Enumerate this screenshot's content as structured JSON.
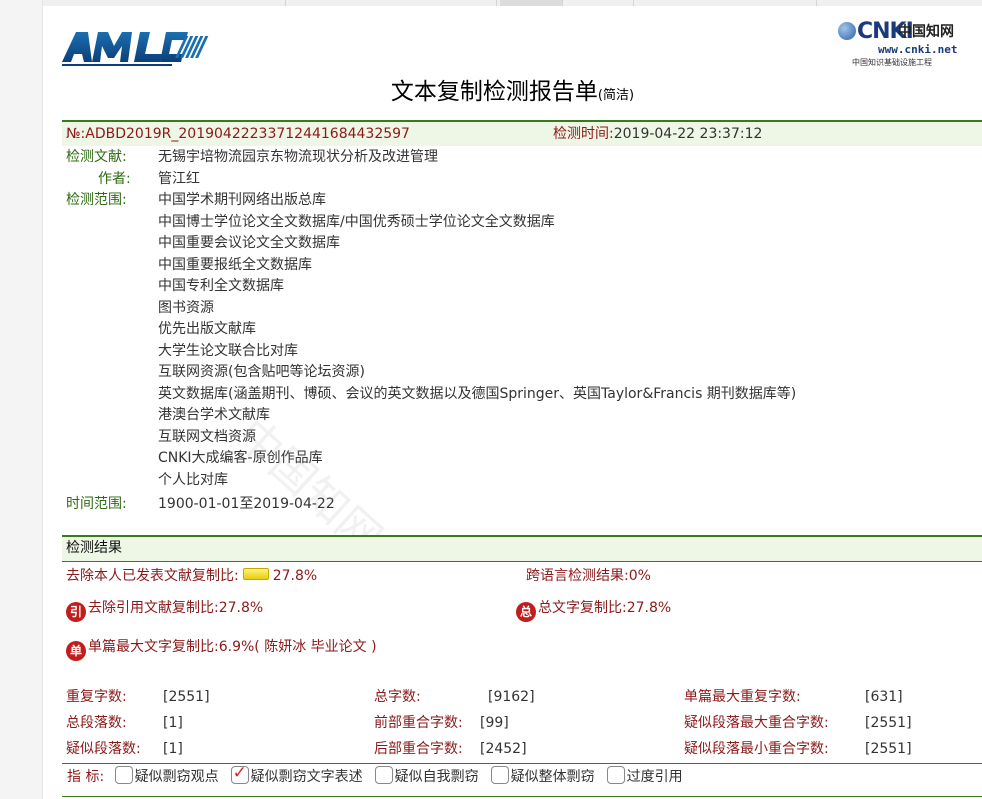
{
  "logos": {
    "amlc": "AMLC",
    "cnki_mark": "CNKI",
    "cnki_chars": "中国知网",
    "cnki_url": "www.cnki.net",
    "cnki_sub": "中国知识基础设施工程"
  },
  "title": {
    "main": "文本复制检测报告单",
    "sub": "(简洁)"
  },
  "report": {
    "number": "№:ADBD2019R_20190422233712441684432597",
    "detect_time_label": "检测时间:",
    "detect_time": "2019-04-22 23:37:12",
    "doc_label": "检测文献:",
    "doc_title": "无锡宇培物流园京东物流现状分析及改进管理",
    "author_label": "作者:",
    "author": "管江红",
    "scope_label": "检测范围:",
    "scope": [
      "中国学术期刊网络出版总库",
      "中国博士学位论文全文数据库/中国优秀硕士学位论文全文数据库",
      "中国重要会议论文全文数据库",
      "中国重要报纸全文数据库",
      "中国专利全文数据库",
      "图书资源",
      "优先出版文献库",
      "大学生论文联合比对库",
      "互联网资源(包含贴吧等论坛资源)",
      "英文数据库(涵盖期刊、博硕、会议的英文数据以及德国Springer、英国Taylor&Francis 期刊数据库等)",
      "港澳台学术文献库",
      "互联网文档资源",
      "CNKI大成编客-原创作品库",
      "个人比对库"
    ],
    "range_label": "时间范围:",
    "range": "1900-01-01至2019-04-22"
  },
  "result": {
    "header": "检测结果",
    "self_excl_label": "去除本人已发表文献复制比:",
    "self_excl_value": "27.8%",
    "cross_label": "跨语言检测结果:",
    "cross_value": "0%",
    "cite_badge": "引",
    "cite_label": "去除引用文献复制比:",
    "cite_value": "27.8%",
    "total_badge": "总",
    "total_label": "总文字复制比:",
    "total_value": "27.8%",
    "single_badge": "单",
    "single_label": "单篇最大文字复制比:",
    "single_value": "6.9%",
    "single_source": "( 陈妍冰 毕业论文 )",
    "stats": {
      "dup_chars_label": "重复字数:",
      "dup_chars": "[2551]",
      "total_chars_label": "总字数:",
      "total_chars": "[9162]",
      "single_max_label": "单篇最大重复字数:",
      "single_max": "[631]",
      "total_paras_label": "总段落数:",
      "total_paras": "[1]",
      "front_label": "前部重合字数:",
      "front": "[99]",
      "susp_max_label": "疑似段落最大重合字数:",
      "susp_max": "[2551]",
      "susp_paras_label": "疑似段落数:",
      "susp_paras": "[1]",
      "back_label": "后部重合字数:",
      "back": "[2452]",
      "susp_min_label": "疑似段落最小重合字数:",
      "susp_min": "[2551]"
    },
    "indicators_label": "指  标:",
    "indicators": [
      {
        "label": "疑似剽窃观点",
        "checked": false
      },
      {
        "label": "疑似剽窃文字表述",
        "checked": true
      },
      {
        "label": "疑似自我剽窃",
        "checked": false
      },
      {
        "label": "疑似整体剽窃",
        "checked": false
      },
      {
        "label": "过度引用",
        "checked": false
      }
    ]
  },
  "colors": {
    "label_red": "#8b1a1a",
    "accent_green": "#2e6b12",
    "badge_red": "#c21d1d"
  }
}
